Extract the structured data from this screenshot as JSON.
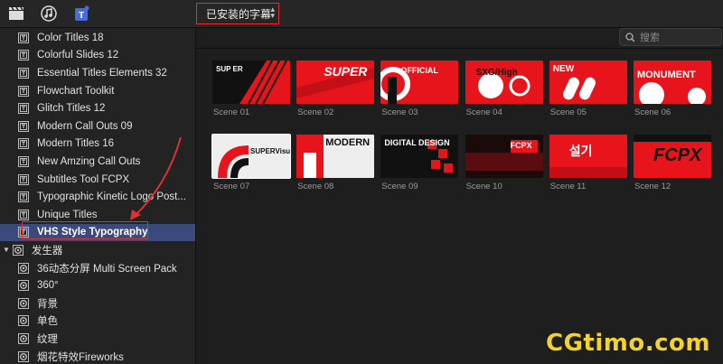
{
  "toolbar": {
    "icons": [
      "clapper-icon",
      "music-icon",
      "titles-icon"
    ],
    "dropdown_label": "已安装的字幕"
  },
  "search": {
    "placeholder": "搜索"
  },
  "sidebar": {
    "items": [
      {
        "label": "Color Titles 18",
        "icon": "title-pack-icon"
      },
      {
        "label": "Colorful Slides 12",
        "icon": "title-pack-icon"
      },
      {
        "label": "Essential Titles Elements 32",
        "icon": "title-pack-icon"
      },
      {
        "label": "Flowchart Toolkit",
        "icon": "title-pack-icon"
      },
      {
        "label": "Glitch Titles 12",
        "icon": "title-pack-icon"
      },
      {
        "label": "Modern Call Outs 09",
        "icon": "title-pack-icon"
      },
      {
        "label": "Modern Titles 16",
        "icon": "title-pack-icon"
      },
      {
        "label": "New Amzing Call Outs",
        "icon": "title-pack-icon"
      },
      {
        "label": "Subtitles Tool FCPX",
        "icon": "title-pack-icon"
      },
      {
        "label": "Typographic Kinetic Logo Post...",
        "icon": "title-pack-icon"
      },
      {
        "label": "Unique Titles",
        "icon": "title-pack-icon"
      },
      {
        "label": "VHS Style Typography",
        "icon": "title-pack-icon",
        "selected": true
      },
      {
        "label": "发生器",
        "icon": "generator-icon",
        "category": true
      },
      {
        "label": "36动态分屏 Multi Screen Pack",
        "icon": "generator-icon"
      },
      {
        "label": "360°",
        "icon": "generator-icon"
      },
      {
        "label": "背景",
        "icon": "generator-icon"
      },
      {
        "label": "单色",
        "icon": "generator-icon"
      },
      {
        "label": "纹理",
        "icon": "generator-icon"
      },
      {
        "label": "烟花特效Fireworks",
        "icon": "generator-icon"
      }
    ]
  },
  "scenes": [
    {
      "label": "Scene 01",
      "caption": "SUP ER"
    },
    {
      "label": "Scene 02",
      "caption": "SUPER"
    },
    {
      "label": "Scene 03",
      "caption": "OFFICIAL"
    },
    {
      "label": "Scene 04",
      "caption": "SXG/High"
    },
    {
      "label": "Scene 05",
      "caption": "NEW"
    },
    {
      "label": "Scene 06",
      "caption": "MONUMENT"
    },
    {
      "label": "Scene 07",
      "caption": "SUPERVisual"
    },
    {
      "label": "Scene 08",
      "caption": "MODERN"
    },
    {
      "label": "Scene 09",
      "caption": "DIGITAL DESIGN"
    },
    {
      "label": "Scene 10",
      "caption": "FCPX"
    },
    {
      "label": "Scene 11",
      "caption": "설기"
    },
    {
      "label": "Scene 12",
      "caption": "FCPX"
    }
  ],
  "watermark": "CGtimo.com",
  "colors": {
    "accent_red": "#e8141c",
    "selection": "#3a4a7a",
    "callout": "#e03030",
    "watermark": "#f3d22a"
  }
}
